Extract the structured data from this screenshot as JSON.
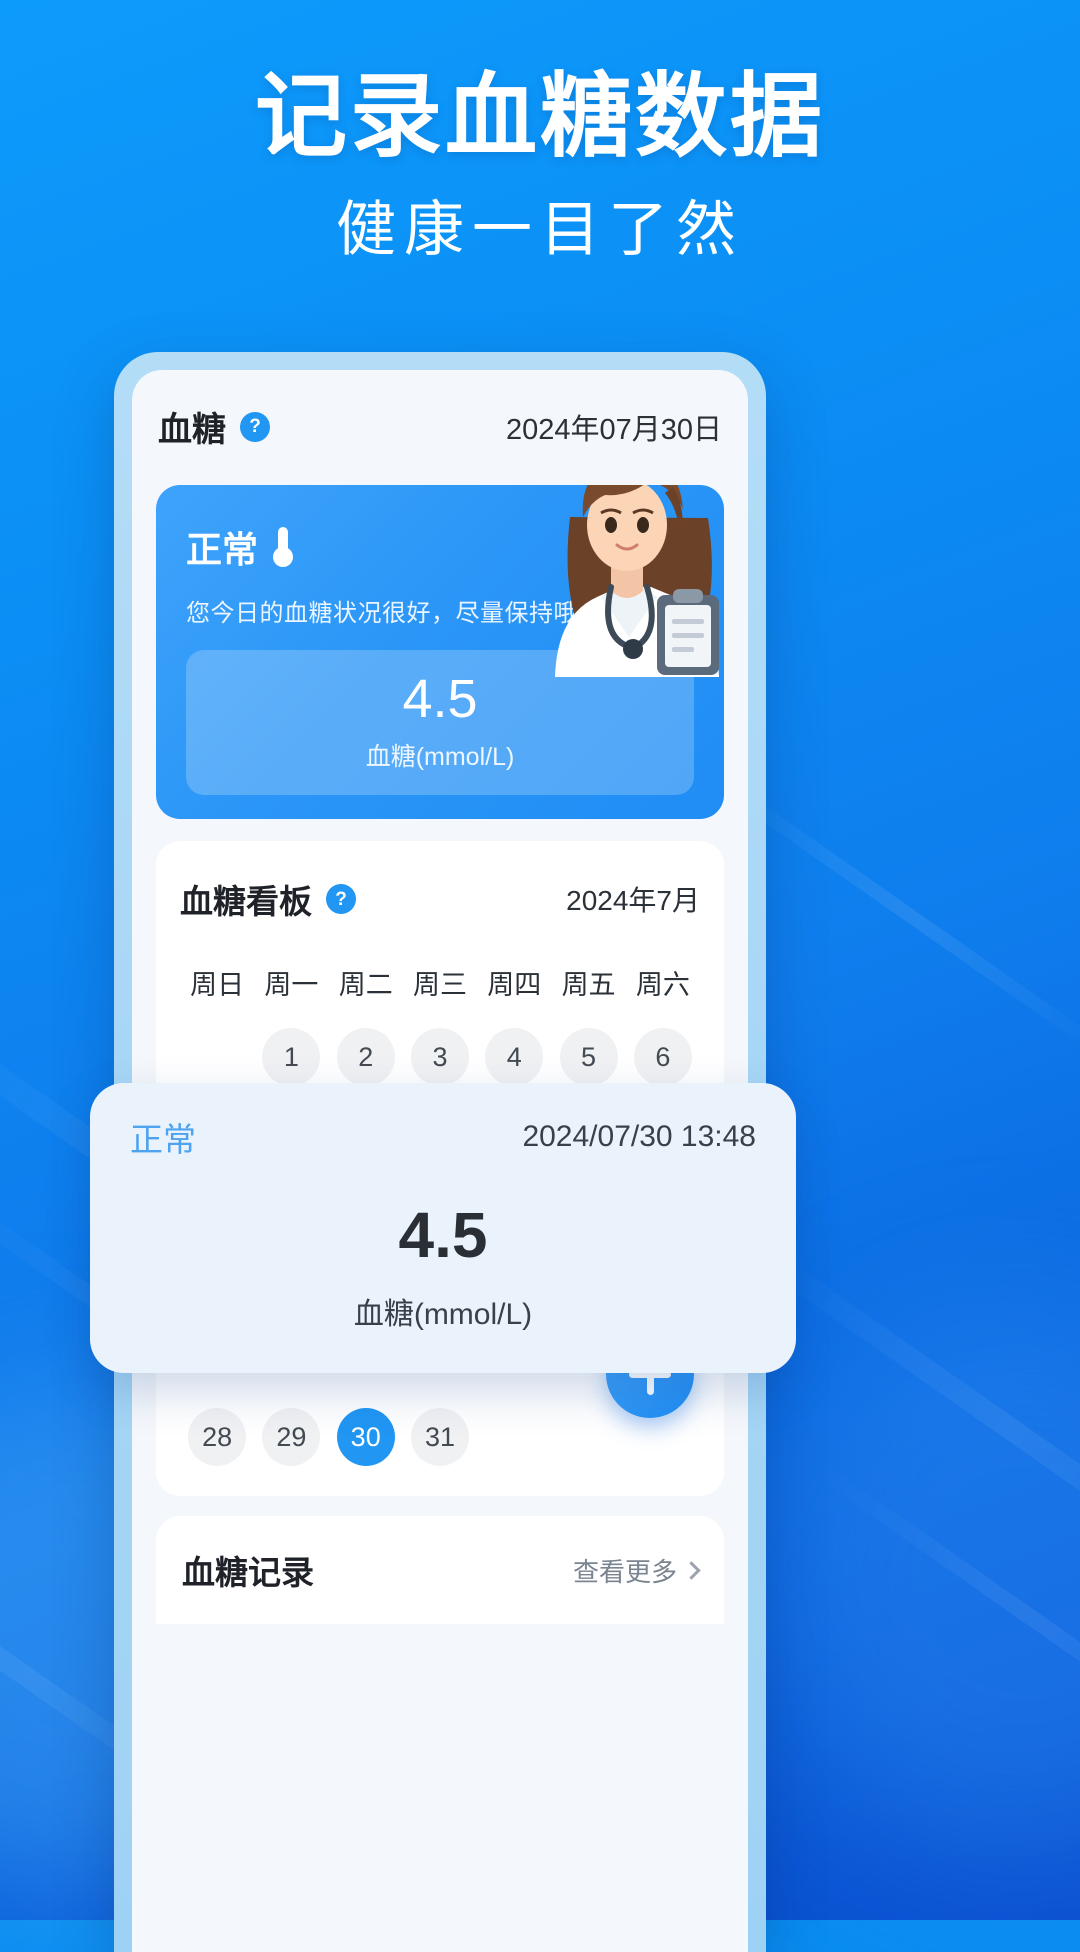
{
  "hero": {
    "title": "记录血糖数据",
    "subtitle": "健康一目了然"
  },
  "app": {
    "header": {
      "title": "血糖",
      "help_icon": "question-mark-icon",
      "help_label": "?",
      "date": "2024年07月30日"
    },
    "status_card": {
      "label": "正常",
      "icon": "thermometer-icon",
      "description": "您今日的血糖状况很好，尽量保持哦",
      "value": "4.5",
      "unit": "血糖(mmol/L)",
      "avatar": "doctor-avatar"
    },
    "board": {
      "title": "血糖看板",
      "help_label": "?",
      "month": "2024年7月",
      "weekdays": [
        "周日",
        "周一",
        "周二",
        "周三",
        "周四",
        "周五",
        "周六"
      ],
      "week_one": [
        "",
        "1",
        "2",
        "3",
        "4",
        "5",
        "6"
      ],
      "last_week": [
        "28",
        "29",
        "30",
        "31",
        "",
        "",
        ""
      ],
      "selected_day": "30"
    },
    "fab": {
      "icon": "plus-icon",
      "label": "+"
    },
    "record": {
      "title": "血糖记录",
      "more_label": "查看更多",
      "more_icon": "chevron-right-icon"
    }
  },
  "popup": {
    "status": "正常",
    "timestamp": "2024/07/30 13:48",
    "value": "4.5",
    "unit": "血糖(mmol/L)"
  },
  "colors": {
    "brand_blue": "#2196f3",
    "bg_blue": "#0a8cf0",
    "card_blue": "#2b96f7",
    "popup_bg": "#eaf3fc"
  }
}
